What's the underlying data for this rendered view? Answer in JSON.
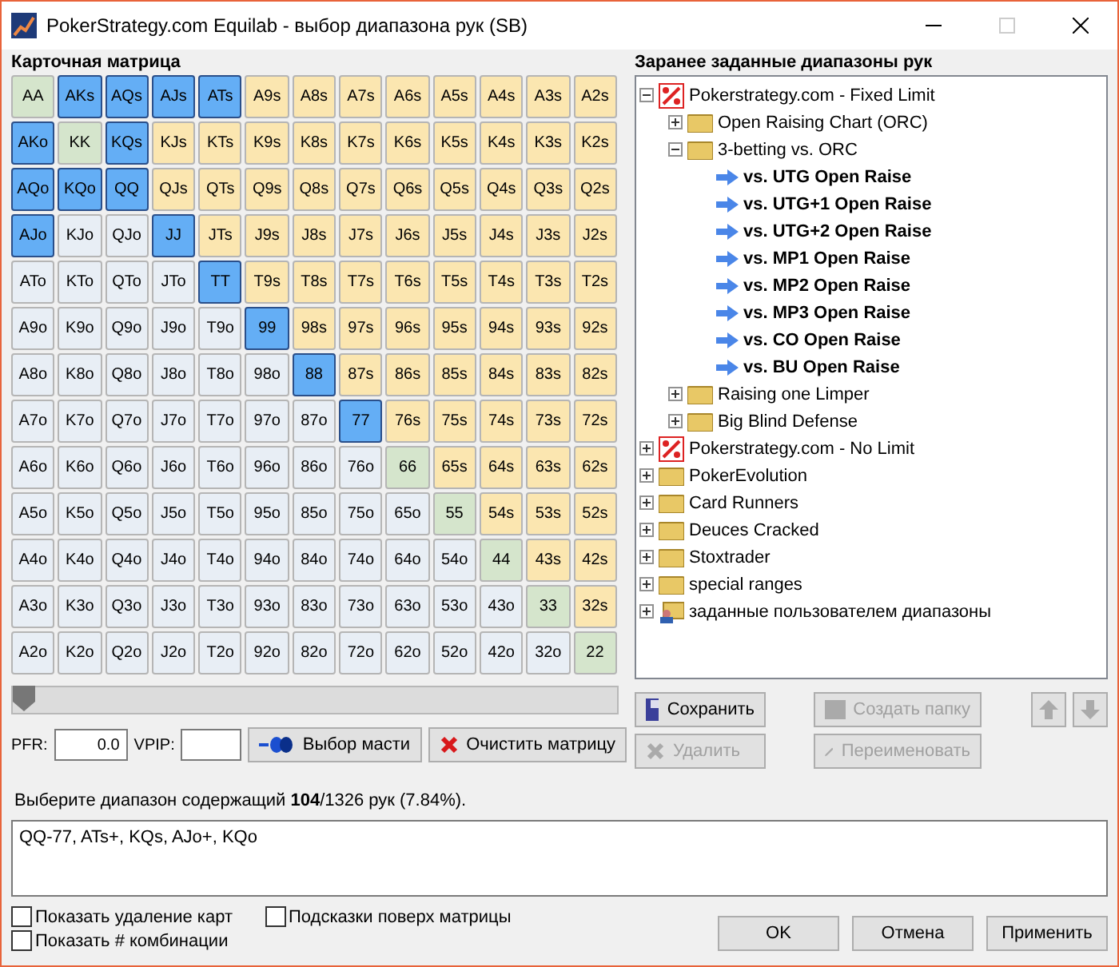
{
  "window": {
    "title": "PokerStrategy.com Equilab - выбор диапазона рук (SB)"
  },
  "matrix": {
    "title": "Карточная матрица",
    "rows": [
      [
        {
          "label": "AA",
          "kind": "pair",
          "selected": false
        },
        {
          "label": "AKs",
          "kind": "suited",
          "selected": true
        },
        {
          "label": "AQs",
          "kind": "suited",
          "selected": true
        },
        {
          "label": "AJs",
          "kind": "suited",
          "selected": true
        },
        {
          "label": "ATs",
          "kind": "suited",
          "selected": true
        },
        {
          "label": "A9s",
          "kind": "suited",
          "selected": false
        },
        {
          "label": "A8s",
          "kind": "suited",
          "selected": false
        },
        {
          "label": "A7s",
          "kind": "suited",
          "selected": false
        },
        {
          "label": "A6s",
          "kind": "suited",
          "selected": false
        },
        {
          "label": "A5s",
          "kind": "suited",
          "selected": false
        },
        {
          "label": "A4s",
          "kind": "suited",
          "selected": false
        },
        {
          "label": "A3s",
          "kind": "suited",
          "selected": false
        },
        {
          "label": "A2s",
          "kind": "suited",
          "selected": false
        }
      ],
      [
        {
          "label": "AKo",
          "kind": "offsuit",
          "selected": true
        },
        {
          "label": "KK",
          "kind": "pair",
          "selected": false
        },
        {
          "label": "KQs",
          "kind": "suited",
          "selected": true
        },
        {
          "label": "KJs",
          "kind": "suited",
          "selected": false
        },
        {
          "label": "KTs",
          "kind": "suited",
          "selected": false
        },
        {
          "label": "K9s",
          "kind": "suited",
          "selected": false
        },
        {
          "label": "K8s",
          "kind": "suited",
          "selected": false
        },
        {
          "label": "K7s",
          "kind": "suited",
          "selected": false
        },
        {
          "label": "K6s",
          "kind": "suited",
          "selected": false
        },
        {
          "label": "K5s",
          "kind": "suited",
          "selected": false
        },
        {
          "label": "K4s",
          "kind": "suited",
          "selected": false
        },
        {
          "label": "K3s",
          "kind": "suited",
          "selected": false
        },
        {
          "label": "K2s",
          "kind": "suited",
          "selected": false
        }
      ],
      [
        {
          "label": "AQo",
          "kind": "offsuit",
          "selected": true
        },
        {
          "label": "KQo",
          "kind": "offsuit",
          "selected": true
        },
        {
          "label": "QQ",
          "kind": "pair",
          "selected": true
        },
        {
          "label": "QJs",
          "kind": "suited",
          "selected": false
        },
        {
          "label": "QTs",
          "kind": "suited",
          "selected": false
        },
        {
          "label": "Q9s",
          "kind": "suited",
          "selected": false
        },
        {
          "label": "Q8s",
          "kind": "suited",
          "selected": false
        },
        {
          "label": "Q7s",
          "kind": "suited",
          "selected": false
        },
        {
          "label": "Q6s",
          "kind": "suited",
          "selected": false
        },
        {
          "label": "Q5s",
          "kind": "suited",
          "selected": false
        },
        {
          "label": "Q4s",
          "kind": "suited",
          "selected": false
        },
        {
          "label": "Q3s",
          "kind": "suited",
          "selected": false
        },
        {
          "label": "Q2s",
          "kind": "suited",
          "selected": false
        }
      ],
      [
        {
          "label": "AJo",
          "kind": "offsuit",
          "selected": true
        },
        {
          "label": "KJo",
          "kind": "offsuit",
          "selected": false
        },
        {
          "label": "QJo",
          "kind": "offsuit",
          "selected": false
        },
        {
          "label": "JJ",
          "kind": "pair",
          "selected": true
        },
        {
          "label": "JTs",
          "kind": "suited",
          "selected": false
        },
        {
          "label": "J9s",
          "kind": "suited",
          "selected": false
        },
        {
          "label": "J8s",
          "kind": "suited",
          "selected": false
        },
        {
          "label": "J7s",
          "kind": "suited",
          "selected": false
        },
        {
          "label": "J6s",
          "kind": "suited",
          "selected": false
        },
        {
          "label": "J5s",
          "kind": "suited",
          "selected": false
        },
        {
          "label": "J4s",
          "kind": "suited",
          "selected": false
        },
        {
          "label": "J3s",
          "kind": "suited",
          "selected": false
        },
        {
          "label": "J2s",
          "kind": "suited",
          "selected": false
        }
      ],
      [
        {
          "label": "ATo",
          "kind": "offsuit",
          "selected": false
        },
        {
          "label": "KTo",
          "kind": "offsuit",
          "selected": false
        },
        {
          "label": "QTo",
          "kind": "offsuit",
          "selected": false
        },
        {
          "label": "JTo",
          "kind": "offsuit",
          "selected": false
        },
        {
          "label": "TT",
          "kind": "pair",
          "selected": true
        },
        {
          "label": "T9s",
          "kind": "suited",
          "selected": false
        },
        {
          "label": "T8s",
          "kind": "suited",
          "selected": false
        },
        {
          "label": "T7s",
          "kind": "suited",
          "selected": false
        },
        {
          "label": "T6s",
          "kind": "suited",
          "selected": false
        },
        {
          "label": "T5s",
          "kind": "suited",
          "selected": false
        },
        {
          "label": "T4s",
          "kind": "suited",
          "selected": false
        },
        {
          "label": "T3s",
          "kind": "suited",
          "selected": false
        },
        {
          "label": "T2s",
          "kind": "suited",
          "selected": false
        }
      ],
      [
        {
          "label": "A9o",
          "kind": "offsuit",
          "selected": false
        },
        {
          "label": "K9o",
          "kind": "offsuit",
          "selected": false
        },
        {
          "label": "Q9o",
          "kind": "offsuit",
          "selected": false
        },
        {
          "label": "J9o",
          "kind": "offsuit",
          "selected": false
        },
        {
          "label": "T9o",
          "kind": "offsuit",
          "selected": false
        },
        {
          "label": "99",
          "kind": "pair",
          "selected": true
        },
        {
          "label": "98s",
          "kind": "suited",
          "selected": false
        },
        {
          "label": "97s",
          "kind": "suited",
          "selected": false
        },
        {
          "label": "96s",
          "kind": "suited",
          "selected": false
        },
        {
          "label": "95s",
          "kind": "suited",
          "selected": false
        },
        {
          "label": "94s",
          "kind": "suited",
          "selected": false
        },
        {
          "label": "93s",
          "kind": "suited",
          "selected": false
        },
        {
          "label": "92s",
          "kind": "suited",
          "selected": false
        }
      ],
      [
        {
          "label": "A8o",
          "kind": "offsuit",
          "selected": false
        },
        {
          "label": "K8o",
          "kind": "offsuit",
          "selected": false
        },
        {
          "label": "Q8o",
          "kind": "offsuit",
          "selected": false
        },
        {
          "label": "J8o",
          "kind": "offsuit",
          "selected": false
        },
        {
          "label": "T8o",
          "kind": "offsuit",
          "selected": false
        },
        {
          "label": "98o",
          "kind": "offsuit",
          "selected": false
        },
        {
          "label": "88",
          "kind": "pair",
          "selected": true
        },
        {
          "label": "87s",
          "kind": "suited",
          "selected": false
        },
        {
          "label": "86s",
          "kind": "suited",
          "selected": false
        },
        {
          "label": "85s",
          "kind": "suited",
          "selected": false
        },
        {
          "label": "84s",
          "kind": "suited",
          "selected": false
        },
        {
          "label": "83s",
          "kind": "suited",
          "selected": false
        },
        {
          "label": "82s",
          "kind": "suited",
          "selected": false
        }
      ],
      [
        {
          "label": "A7o",
          "kind": "offsuit",
          "selected": false
        },
        {
          "label": "K7o",
          "kind": "offsuit",
          "selected": false
        },
        {
          "label": "Q7o",
          "kind": "offsuit",
          "selected": false
        },
        {
          "label": "J7o",
          "kind": "offsuit",
          "selected": false
        },
        {
          "label": "T7o",
          "kind": "offsuit",
          "selected": false
        },
        {
          "label": "97o",
          "kind": "offsuit",
          "selected": false
        },
        {
          "label": "87o",
          "kind": "offsuit",
          "selected": false
        },
        {
          "label": "77",
          "kind": "pair",
          "selected": true
        },
        {
          "label": "76s",
          "kind": "suited",
          "selected": false
        },
        {
          "label": "75s",
          "kind": "suited",
          "selected": false
        },
        {
          "label": "74s",
          "kind": "suited",
          "selected": false
        },
        {
          "label": "73s",
          "kind": "suited",
          "selected": false
        },
        {
          "label": "72s",
          "kind": "suited",
          "selected": false
        }
      ],
      [
        {
          "label": "A6o",
          "kind": "offsuit",
          "selected": false
        },
        {
          "label": "K6o",
          "kind": "offsuit",
          "selected": false
        },
        {
          "label": "Q6o",
          "kind": "offsuit",
          "selected": false
        },
        {
          "label": "J6o",
          "kind": "offsuit",
          "selected": false
        },
        {
          "label": "T6o",
          "kind": "offsuit",
          "selected": false
        },
        {
          "label": "96o",
          "kind": "offsuit",
          "selected": false
        },
        {
          "label": "86o",
          "kind": "offsuit",
          "selected": false
        },
        {
          "label": "76o",
          "kind": "offsuit",
          "selected": false
        },
        {
          "label": "66",
          "kind": "pair",
          "selected": false
        },
        {
          "label": "65s",
          "kind": "suited",
          "selected": false
        },
        {
          "label": "64s",
          "kind": "suited",
          "selected": false
        },
        {
          "label": "63s",
          "kind": "suited",
          "selected": false
        },
        {
          "label": "62s",
          "kind": "suited",
          "selected": false
        }
      ],
      [
        {
          "label": "A5o",
          "kind": "offsuit",
          "selected": false
        },
        {
          "label": "K5o",
          "kind": "offsuit",
          "selected": false
        },
        {
          "label": "Q5o",
          "kind": "offsuit",
          "selected": false
        },
        {
          "label": "J5o",
          "kind": "offsuit",
          "selected": false
        },
        {
          "label": "T5o",
          "kind": "offsuit",
          "selected": false
        },
        {
          "label": "95o",
          "kind": "offsuit",
          "selected": false
        },
        {
          "label": "85o",
          "kind": "offsuit",
          "selected": false
        },
        {
          "label": "75o",
          "kind": "offsuit",
          "selected": false
        },
        {
          "label": "65o",
          "kind": "offsuit",
          "selected": false
        },
        {
          "label": "55",
          "kind": "pair",
          "selected": false
        },
        {
          "label": "54s",
          "kind": "suited",
          "selected": false
        },
        {
          "label": "53s",
          "kind": "suited",
          "selected": false
        },
        {
          "label": "52s",
          "kind": "suited",
          "selected": false
        }
      ],
      [
        {
          "label": "A4o",
          "kind": "offsuit",
          "selected": false
        },
        {
          "label": "K4o",
          "kind": "offsuit",
          "selected": false
        },
        {
          "label": "Q4o",
          "kind": "offsuit",
          "selected": false
        },
        {
          "label": "J4o",
          "kind": "offsuit",
          "selected": false
        },
        {
          "label": "T4o",
          "kind": "offsuit",
          "selected": false
        },
        {
          "label": "94o",
          "kind": "offsuit",
          "selected": false
        },
        {
          "label": "84o",
          "kind": "offsuit",
          "selected": false
        },
        {
          "label": "74o",
          "kind": "offsuit",
          "selected": false
        },
        {
          "label": "64o",
          "kind": "offsuit",
          "selected": false
        },
        {
          "label": "54o",
          "kind": "offsuit",
          "selected": false
        },
        {
          "label": "44",
          "kind": "pair",
          "selected": false
        },
        {
          "label": "43s",
          "kind": "suited",
          "selected": false
        },
        {
          "label": "42s",
          "kind": "suited",
          "selected": false
        }
      ],
      [
        {
          "label": "A3o",
          "kind": "offsuit",
          "selected": false
        },
        {
          "label": "K3o",
          "kind": "offsuit",
          "selected": false
        },
        {
          "label": "Q3o",
          "kind": "offsuit",
          "selected": false
        },
        {
          "label": "J3o",
          "kind": "offsuit",
          "selected": false
        },
        {
          "label": "T3o",
          "kind": "offsuit",
          "selected": false
        },
        {
          "label": "93o",
          "kind": "offsuit",
          "selected": false
        },
        {
          "label": "83o",
          "kind": "offsuit",
          "selected": false
        },
        {
          "label": "73o",
          "kind": "offsuit",
          "selected": false
        },
        {
          "label": "63o",
          "kind": "offsuit",
          "selected": false
        },
        {
          "label": "53o",
          "kind": "offsuit",
          "selected": false
        },
        {
          "label": "43o",
          "kind": "offsuit",
          "selected": false
        },
        {
          "label": "33",
          "kind": "pair",
          "selected": false
        },
        {
          "label": "32s",
          "kind": "suited",
          "selected": false
        }
      ],
      [
        {
          "label": "A2o",
          "kind": "offsuit",
          "selected": false
        },
        {
          "label": "K2o",
          "kind": "offsuit",
          "selected": false
        },
        {
          "label": "Q2o",
          "kind": "offsuit",
          "selected": false
        },
        {
          "label": "J2o",
          "kind": "offsuit",
          "selected": false
        },
        {
          "label": "T2o",
          "kind": "offsuit",
          "selected": false
        },
        {
          "label": "92o",
          "kind": "offsuit",
          "selected": false
        },
        {
          "label": "82o",
          "kind": "offsuit",
          "selected": false
        },
        {
          "label": "72o",
          "kind": "offsuit",
          "selected": false
        },
        {
          "label": "62o",
          "kind": "offsuit",
          "selected": false
        },
        {
          "label": "52o",
          "kind": "offsuit",
          "selected": false
        },
        {
          "label": "42o",
          "kind": "offsuit",
          "selected": false
        },
        {
          "label": "32o",
          "kind": "offsuit",
          "selected": false
        },
        {
          "label": "22",
          "kind": "pair",
          "selected": false
        }
      ]
    ]
  },
  "slider": {
    "level": 0
  },
  "pfr": {
    "label": "PFR:",
    "value": "0.0"
  },
  "vpip": {
    "label": "VPIP:"
  },
  "matrix_buttons": [
    {
      "label": "Выбор масти",
      "kind": "suits"
    },
    {
      "label": "Очистить матрицу",
      "kind": "clear"
    }
  ],
  "ranges": {
    "title": "Заранее заданные диапазоны рук",
    "tree": [
      {
        "label": "Pokerstrategy.com - Fixed Limit",
        "kind": "logo",
        "expanded": true,
        "children": [
          {
            "label": "Open Raising Chart (ORC)",
            "kind": "folder",
            "expanded": false
          },
          {
            "label": "3-betting vs. ORC",
            "kind": "folder",
            "expanded": true,
            "children": [
              {
                "label": "vs. UTG Open Raise",
                "kind": "range"
              },
              {
                "label": "vs. UTG+1 Open Raise",
                "kind": "range"
              },
              {
                "label": "vs. UTG+2 Open Raise",
                "kind": "range"
              },
              {
                "label": "vs. MP1 Open Raise",
                "kind": "range"
              },
              {
                "label": "vs. MP2 Open Raise",
                "kind": "range"
              },
              {
                "label": "vs. MP3 Open Raise",
                "kind": "range"
              },
              {
                "label": "vs. CO Open Raise",
                "kind": "range"
              },
              {
                "label": "vs. BU Open Raise",
                "kind": "range"
              }
            ]
          },
          {
            "label": "Raising one Limper",
            "kind": "folder",
            "expanded": false
          },
          {
            "label": "Big Blind Defense",
            "kind": "folder",
            "expanded": false
          }
        ]
      },
      {
        "label": "Pokerstrategy.com - No Limit",
        "kind": "logo",
        "expanded": false
      },
      {
        "label": "PokerEvolution",
        "kind": "folder",
        "expanded": false
      },
      {
        "label": "Card Runners",
        "kind": "folder",
        "expanded": false
      },
      {
        "label": "Deuces Cracked",
        "kind": "folder",
        "expanded": false
      },
      {
        "label": "Stoxtrader",
        "kind": "folder",
        "expanded": false
      },
      {
        "label": "special ranges",
        "kind": "folder",
        "expanded": false
      },
      {
        "label": "заданные пользователем диапазоны",
        "kind": "user",
        "expanded": false
      }
    ]
  },
  "tree_buttons": [
    {
      "label": "Сохранить",
      "kind": "save",
      "disabled": false
    },
    {
      "label": "Создать папку",
      "kind": "folder",
      "disabled": true
    },
    {
      "kind": "up",
      "disabled": true
    },
    {
      "kind": "down",
      "disabled": true
    },
    {
      "label": "Удалить",
      "kind": "delete",
      "disabled": true
    },
    {
      "label": "Переименовать",
      "kind": "rename",
      "disabled": true
    }
  ],
  "summary": "Выберите диапазон содержащий **104**/1326 рук (7.84%).",
  "range_text": "QQ-77, ATs+, KQs, AJo+, KQo",
  "options": [
    {
      "label": "Показать удаление карт",
      "checked": false
    },
    {
      "label": "Подсказки поверх матрицы",
      "checked": false
    },
    {
      "label": "Показать # комбинации",
      "checked": false
    }
  ],
  "dialog_buttons": [
    {
      "label": "OK"
    },
    {
      "label": "Отмена"
    },
    {
      "label": "Применить"
    }
  ]
}
